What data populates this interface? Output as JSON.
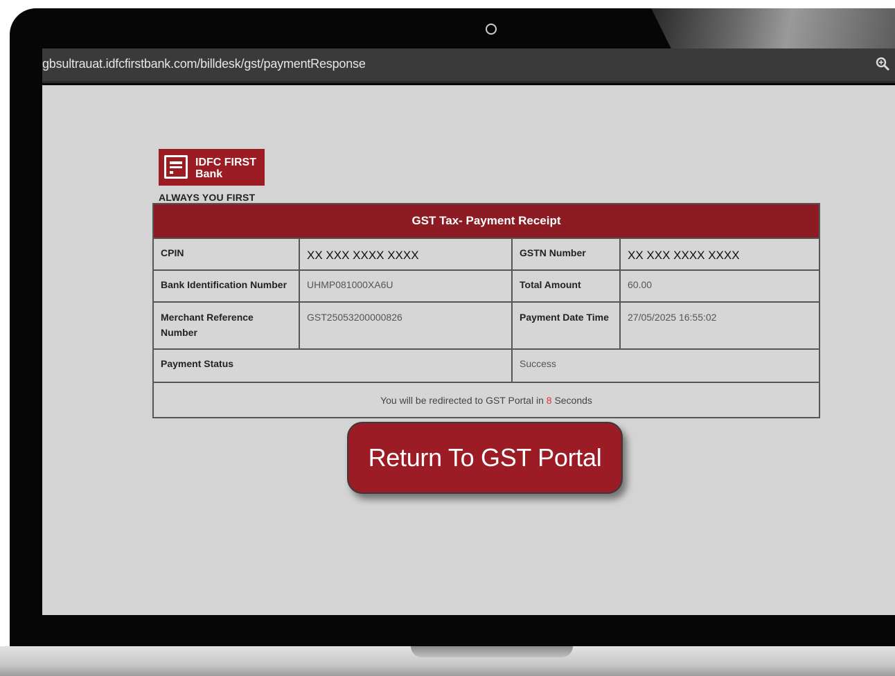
{
  "browser": {
    "url": "gbsultrauat.idfcfirstbank.com/billdesk/gst/paymentResponse",
    "zoom_icon": "magnifier-icon"
  },
  "logo": {
    "line1": "IDFC FIRST",
    "line2": "Bank",
    "tagline": "ALWAYS YOU FIRST",
    "brand_color": "#9b1c23"
  },
  "receipt": {
    "title": "GST Tax- Payment Receipt",
    "cpin_label": "CPIN",
    "cpin_value": "XX XXX XXXX XXXX",
    "gstn_label": "GSTN Number",
    "gstn_value": "XX XXX XXXX XXXX",
    "bin_label": "Bank Identification Number",
    "bin_value": "UHMP081000XA6U",
    "amount_label": "Total Amount",
    "amount_value": "60.00",
    "mrn_label": "Merchant Reference Number",
    "mrn_value": "GST25053200000826",
    "datetime_label": "Payment Date Time",
    "datetime_value": "27/05/2025 16:55:02",
    "status_label": "Payment Status",
    "status_value": "Success",
    "redirect_prefix": "You will be redirected to GST Portal in",
    "redirect_seconds": "8",
    "redirect_suffix": "Seconds"
  },
  "actions": {
    "return_label": "Return To GST Portal"
  }
}
